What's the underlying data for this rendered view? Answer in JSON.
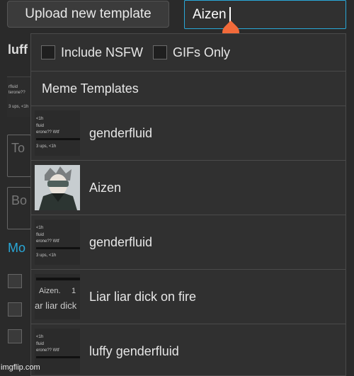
{
  "toolbar": {
    "upload_label": "Upload new template",
    "search_value": "Aizen"
  },
  "background": {
    "heading_fragment": "luff",
    "top_text_placeholder": "To",
    "bottom_text_placeholder": "Bo",
    "more_link": "Mo",
    "thumb_lines": [
      "rfluid",
      "terone??",
      "3 ups, <1h"
    ]
  },
  "dropdown": {
    "filters": [
      {
        "label": "Include NSFW",
        "checked": false
      },
      {
        "label": "GIFs Only",
        "checked": false
      }
    ],
    "section_title": "Meme Templates",
    "items": [
      {
        "name": "genderfluid",
        "thumb_lines": [
          "<1h",
          "fluid",
          "erone?? Wtf",
          "3 ups, <1h"
        ]
      },
      {
        "name": "Aizen",
        "thumb_lines": []
      },
      {
        "name": "genderfluid",
        "thumb_lines": [
          "<1h",
          "fluid",
          "erone?? Wtf",
          "3 ups, <1h"
        ]
      },
      {
        "name": "Liar liar dick on fire",
        "thumb_lines": [
          "Aizen.",
          "1",
          "ar liar dick"
        ]
      },
      {
        "name": "luffy genderfluid",
        "thumb_lines": [
          "<1h",
          "fluid",
          "erone?? Wtf"
        ]
      }
    ]
  },
  "watermark": "imgflip.com",
  "colors": {
    "accent": "#29a8d8",
    "handle": "#f26a3a"
  }
}
